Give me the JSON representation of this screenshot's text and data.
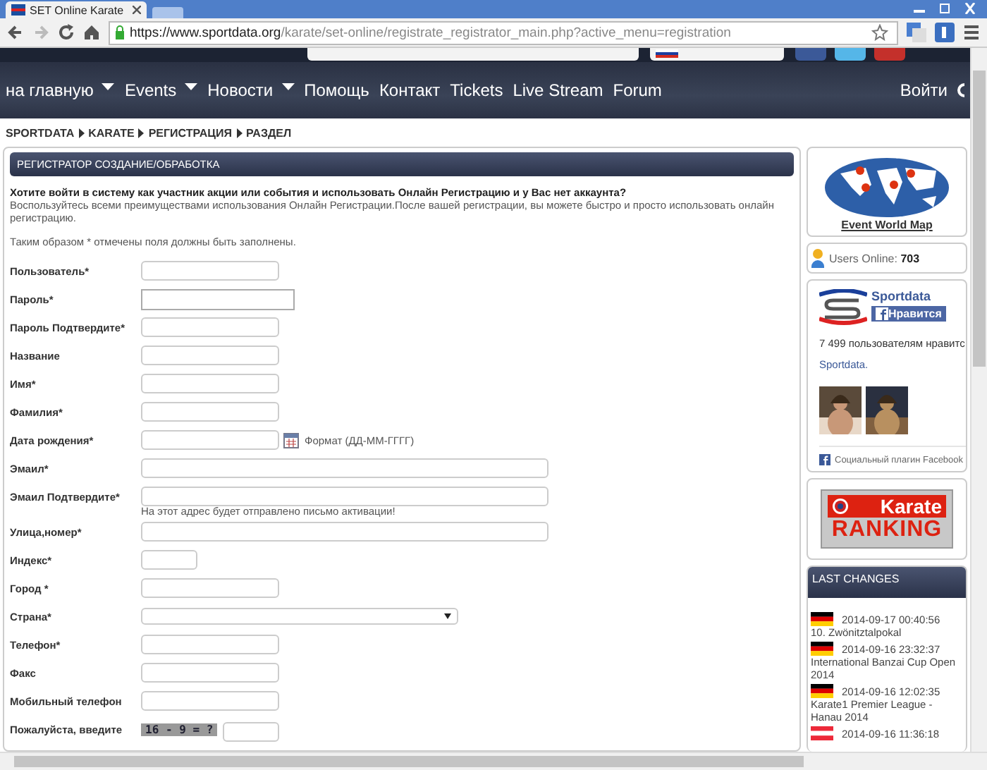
{
  "browser": {
    "tab_title": "SET Online Karate",
    "url_secure": "https://www.sportdata.org",
    "url_rest": "/karate/set-online/registrate_registrator_main.php?active_menu=registration"
  },
  "nav": {
    "items": [
      {
        "label": "на главную",
        "has_menu": true
      },
      {
        "label": "Events",
        "has_menu": true
      },
      {
        "label": "Новости",
        "has_menu": true
      },
      {
        "label": "Помощь",
        "has_menu": false
      },
      {
        "label": "Контакт",
        "has_menu": false
      },
      {
        "label": "Tickets",
        "has_menu": false
      },
      {
        "label": "Live Stream",
        "has_menu": false
      },
      {
        "label": "Forum",
        "has_menu": false
      }
    ],
    "login": "Войти"
  },
  "breadcrumb": [
    "SPORTDATA",
    "KARATE",
    "РЕГИСТРАЦИЯ",
    "РАЗДЕЛ"
  ],
  "panel": {
    "title": "РЕГИСТРАТОР СОЗДАНИЕ/ОБРАБОТКА",
    "question": "Хотите войти в систему как участник акции или события и использовать Онлайн Регистрацию и у Вас нет аккаунта?",
    "intro": "Воспользуйтесь всеми преимуществами использования Онлайн Регистрации.После вашей регистрации, вы можете быстро и просто использовать онлайн регистрацию.",
    "required_note": "Таким образом * отмечены поля должны быть заполнены.",
    "fields": [
      {
        "label": "Пользователь*",
        "kind": "text"
      },
      {
        "label": "Пароль*",
        "kind": "password"
      },
      {
        "label": "Пароль Подтвердите*",
        "kind": "text"
      },
      {
        "label": "Название",
        "kind": "text"
      },
      {
        "label": "Имя*",
        "kind": "text"
      },
      {
        "label": "Фамилия*",
        "kind": "text"
      },
      {
        "label": "Дата рождения*",
        "kind": "date",
        "format": "Формат (ДД-ММ-ГГГГ)"
      },
      {
        "label": "Эмаил*",
        "kind": "wide"
      },
      {
        "label": "Эмаил Подтвердите*",
        "kind": "wide",
        "hint": "На этот адрес будет отправлено письмо активации!"
      },
      {
        "label": "Улица,номер*",
        "kind": "wide"
      },
      {
        "label": "Индекс*",
        "kind": "small"
      },
      {
        "label": "Город *",
        "kind": "text"
      },
      {
        "label": "Страна*",
        "kind": "select"
      },
      {
        "label": "Телефон*",
        "kind": "text"
      },
      {
        "label": "Факс",
        "kind": "text"
      },
      {
        "label": "Мобильный телефон",
        "kind": "text"
      },
      {
        "label": "Пожалуйста, введите",
        "kind": "captcha",
        "question": "16 - 9 = ?"
      }
    ]
  },
  "sidebar": {
    "map_label": "Event World Map",
    "users_online_label": "Users Online:",
    "users_online": "703",
    "facebook": {
      "page": "Sportdata",
      "like": "Нравится",
      "likes_text": "7 499 пользователям нравитс",
      "likes_page": "Sportdata.",
      "plugin": "Социальный плагин Facebook"
    },
    "ranking": {
      "line1": "Karate",
      "line2": "RANKING"
    },
    "last_changes": {
      "title": "LAST CHANGES",
      "items": [
        {
          "kind": "de",
          "date": "2014-09-17 00:40:56",
          "name": "10. Zwönitztalpokal"
        },
        {
          "kind": "de",
          "date": "2014-09-16 23:32:37",
          "name": "International Banzai Cup Open 2014"
        },
        {
          "kind": "de",
          "date": "2014-09-16 12:02:35",
          "name": "Karate1 Premier League - Hanau 2014"
        },
        {
          "kind": "at",
          "date": "2014-09-16 11:36:18"
        }
      ]
    }
  }
}
